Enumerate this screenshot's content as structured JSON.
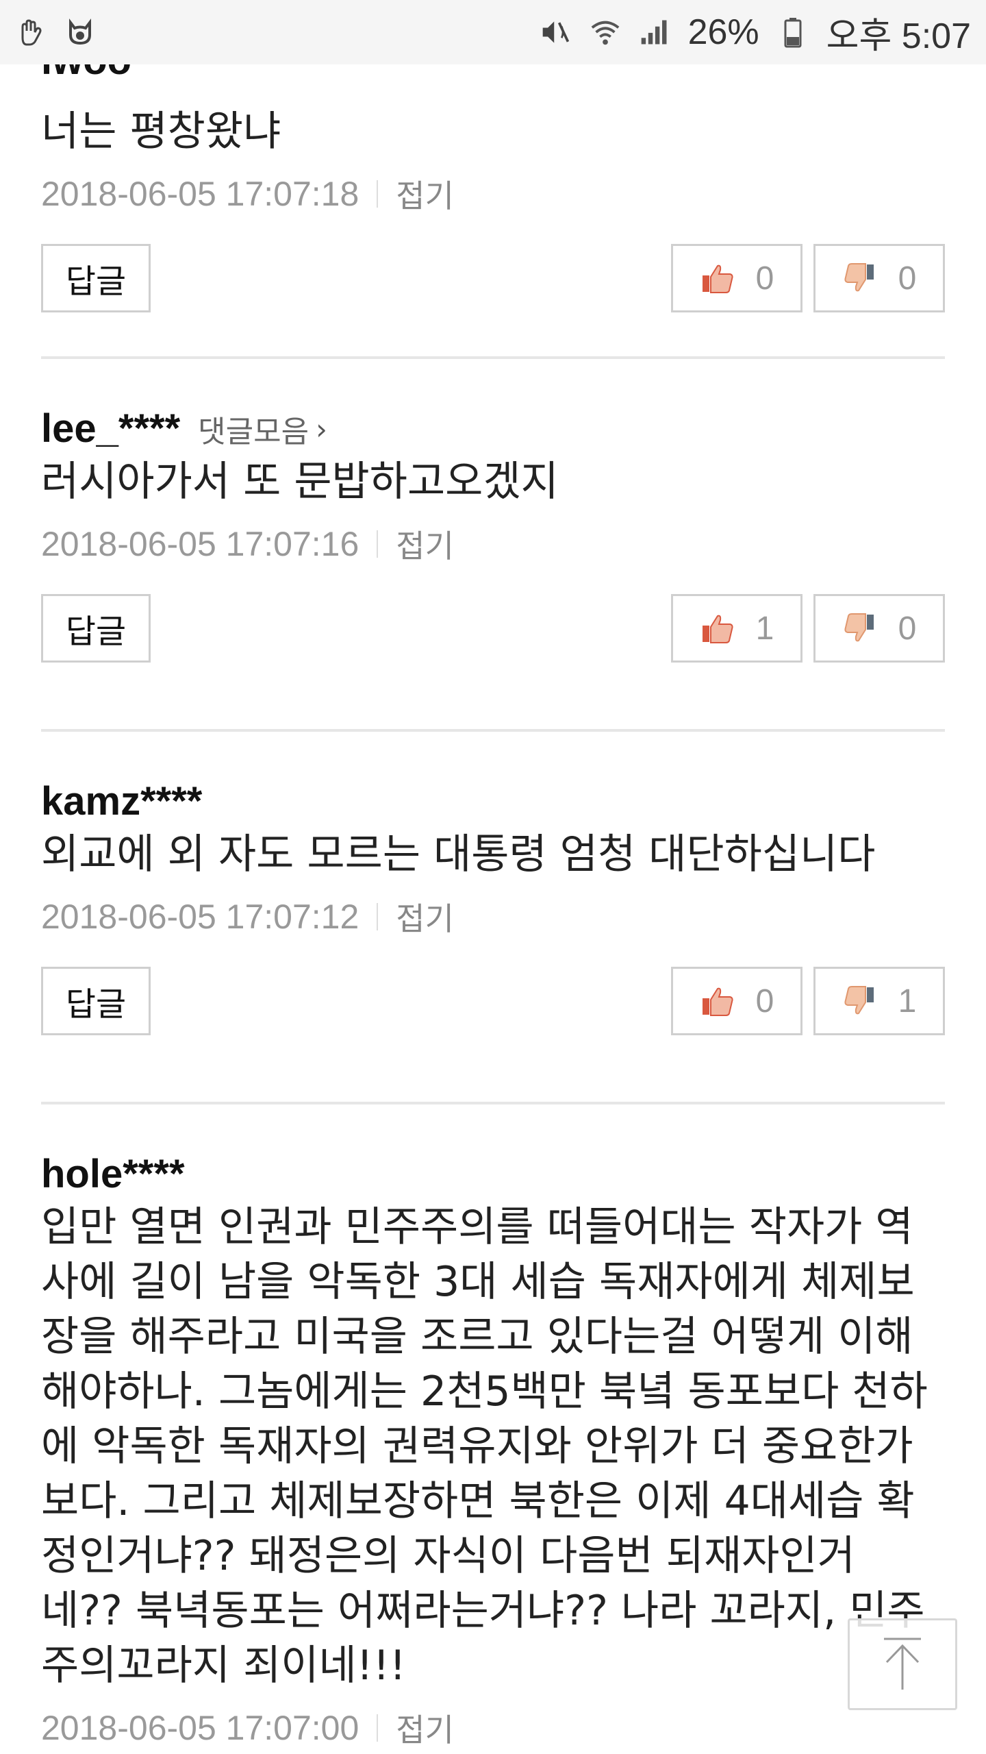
{
  "status_bar": {
    "battery_percent": "26%",
    "time": "오후 5:07",
    "icons": [
      "hand-icon",
      "cat-icon",
      "mute-icon",
      "wifi-icon",
      "signal-icon",
      "battery-icon"
    ]
  },
  "partial_top_author": "iwoo",
  "collect_label": "댓글모음",
  "reply_label": "답글",
  "fold_label": "접기",
  "comments": [
    {
      "author": "",
      "text": "너는 평창왔냐",
      "date": "2018-06-05 17:07:18",
      "likes": "0",
      "dislikes": "0"
    },
    {
      "author": "lee_****",
      "text": "러시아가서 또 문밥하고오겠지",
      "date": "2018-06-05 17:07:16",
      "likes": "1",
      "dislikes": "0"
    },
    {
      "author": "kamz****",
      "text": "외교에 외 자도 모르는 대통령 엄청 대단하십니다",
      "date": "2018-06-05 17:07:12",
      "likes": "0",
      "dislikes": "1"
    },
    {
      "author": "hole****",
      "text_lines": [
        "입만 열면 인권과 민주주의를 떠들어대는 작자가 역",
        "사에 길이 남을 악독한 3대 세습 독재자에게 체제보",
        "장을 해주라고 미국을 조르고 있다는걸 어떻게 이해",
        "해야하나. 그놈에게는 2천5백만 북녘 동포보다 천하",
        "에 악독한 독재자의 권력유지와 안위가 더 중요한가",
        "보다. 그리고 체제보장하면 북한은 이제 4대세습 확",
        "정인거냐?? 돼정은의 자식이 다음번 되재자인거",
        "네?? 북녁동포는 어쩌라는거냐?? 나라 꼬라지, 민주",
        "주의꼬라지 죄이네!!!"
      ],
      "date": "2018-06-05 17:07:00"
    }
  ],
  "colors": {
    "like_thumb": "#e8735a",
    "dislike_thumb": "#e8a07a",
    "divider": "#e6e6e6",
    "date_gray": "#999999"
  }
}
